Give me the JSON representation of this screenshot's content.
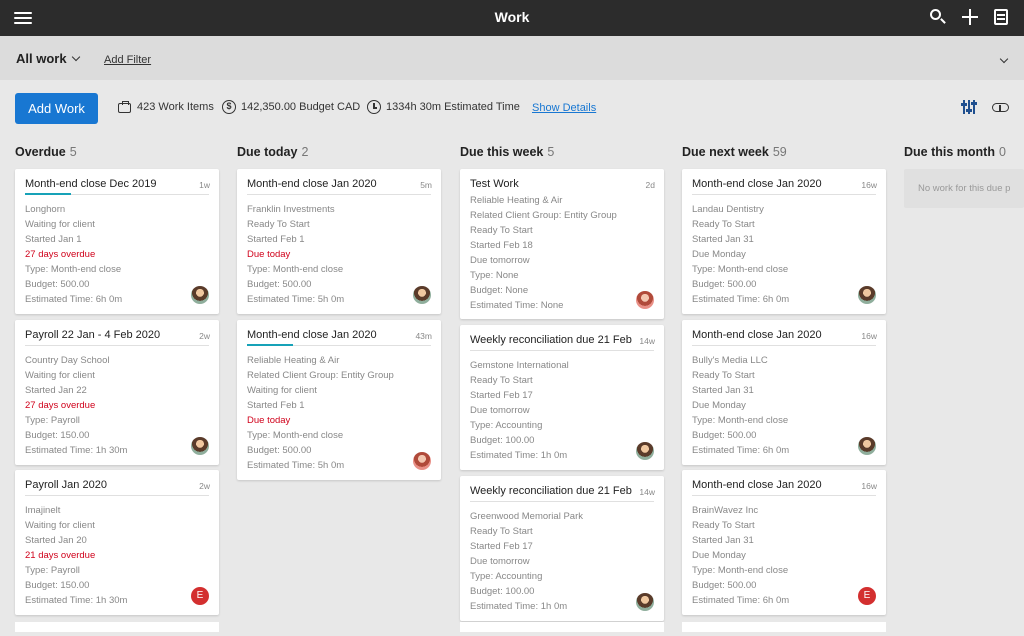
{
  "topbar": {
    "title": "Work",
    "icons": [
      "menu-icon",
      "search-icon",
      "plus-icon",
      "notes-icon"
    ]
  },
  "filterbar": {
    "view_label": "All work",
    "add_filter": "Add Filter"
  },
  "stats": {
    "add_work": "Add Work",
    "work_items": "423 Work Items",
    "budget": "142,350.00 Budget CAD",
    "estimated": "1334h 30m Estimated Time",
    "show_details": "Show Details",
    "coin_glyph": "$"
  },
  "columns": [
    {
      "title": "Overdue",
      "count": "5",
      "cards": [
        {
          "title": "Month-end close Dec 2019",
          "age": "1w",
          "progress": true,
          "lines": [
            "Longhorn",
            "Waiting for client",
            "Started Jan 1",
            "27 days overdue",
            "Type: Month-end close",
            "Budget: 500.00",
            "Estimated Time: 6h 0m"
          ],
          "avatar": "photo"
        },
        {
          "title": "Payroll 22 Jan - 4 Feb 2020",
          "age": "2w",
          "lines": [
            "Country Day School",
            "Waiting for client",
            "Started Jan 22",
            "27 days overdue",
            "Type: Payroll",
            "Budget: 150.00",
            "Estimated Time: 1h 30m"
          ],
          "avatar": "photo"
        },
        {
          "title": "Payroll Jan 2020",
          "age": "2w",
          "lines": [
            "Imajinelt",
            "Waiting for client",
            "Started Jan 20",
            "21 days overdue",
            "Type: Payroll",
            "Budget: 150.00",
            "Estimated Time: 1h 30m"
          ],
          "avatar": "E"
        }
      ]
    },
    {
      "title": "Due today",
      "count": "2",
      "cards": [
        {
          "title": "Month-end close Jan 2020",
          "age": "5m",
          "lines": [
            "Franklin Investments",
            "Ready To Start",
            "Started Feb 1",
            "Due today",
            "Type: Month-end close",
            "Budget: 500.00",
            "Estimated Time: 5h 0m"
          ],
          "avatar": "photo"
        },
        {
          "title": "Month-end close Jan 2020",
          "age": "43m",
          "progress": true,
          "lines": [
            "Reliable Heating & Air",
            "Related Client Group: Entity Group",
            "Waiting for client",
            "Started Feb 1",
            "Due today",
            "Type: Month-end close",
            "Budget: 500.00",
            "Estimated Time: 5h 0m"
          ],
          "avatar": "photo-alt"
        }
      ]
    },
    {
      "title": "Due this week",
      "count": "5",
      "cards": [
        {
          "title": "Test Work",
          "age": "2d",
          "lines": [
            "Reliable Heating & Air",
            "Related Client Group: Entity Group",
            "Ready To Start",
            "Started Feb 18",
            "Due tomorrow",
            "Type: None",
            "Budget: None",
            "Estimated Time: None"
          ],
          "avatar": "photo-alt"
        },
        {
          "title": "Weekly reconciliation due 21 Feb",
          "age": "14w",
          "lines": [
            "Gemstone International",
            "Ready To Start",
            "Started Feb 17",
            "Due tomorrow",
            "Type: Accounting",
            "Budget: 100.00",
            "Estimated Time: 1h 0m"
          ],
          "avatar": "photo"
        },
        {
          "title": "Weekly reconciliation due 21 Feb",
          "age": "14w",
          "lines": [
            "Greenwood Memorial Park",
            "Ready To Start",
            "Started Feb 17",
            "Due tomorrow",
            "Type: Accounting",
            "Budget: 100.00",
            "Estimated Time: 1h 0m"
          ],
          "avatar": "photo"
        }
      ]
    },
    {
      "title": "Due next week",
      "count": "59",
      "cards": [
        {
          "title": "Month-end close Jan 2020",
          "age": "16w",
          "lines": [
            "Landau Dentistry",
            "Ready To Start",
            "Started Jan 31",
            "Due Monday",
            "Type: Month-end close",
            "Budget: 500.00",
            "Estimated Time: 6h 0m"
          ],
          "avatar": "photo"
        },
        {
          "title": "Month-end close Jan 2020",
          "age": "16w",
          "lines": [
            "Bully's Media LLC",
            "Ready To Start",
            "Started Jan 31",
            "Due Monday",
            "Type: Month-end close",
            "Budget: 500.00",
            "Estimated Time: 6h 0m"
          ],
          "avatar": "photo"
        },
        {
          "title": "Month-end close Jan 2020",
          "age": "16w",
          "lines": [
            "BrainWavez Inc",
            "Ready To Start",
            "Started Jan 31",
            "Due Monday",
            "Type: Month-end close",
            "Budget: 500.00",
            "Estimated Time: 6h 0m"
          ],
          "avatar": "E"
        }
      ]
    },
    {
      "title": "Due this month",
      "count": "0",
      "empty_text": "No work for this due p",
      "cards": []
    }
  ]
}
